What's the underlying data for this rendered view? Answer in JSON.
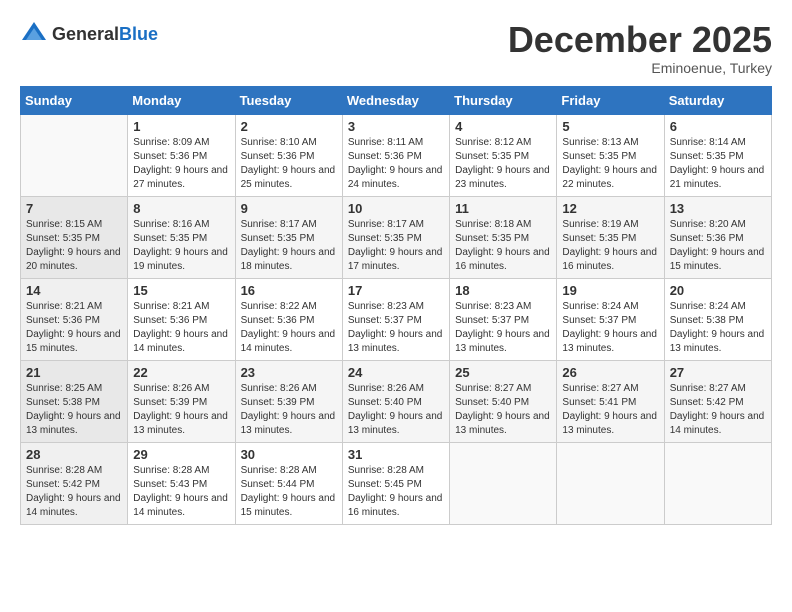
{
  "header": {
    "logo_general": "General",
    "logo_blue": "Blue",
    "month_title": "December 2025",
    "subtitle": "Eminoenue, Turkey"
  },
  "weekdays": [
    "Sunday",
    "Monday",
    "Tuesday",
    "Wednesday",
    "Thursday",
    "Friday",
    "Saturday"
  ],
  "weeks": [
    [
      {
        "day": "",
        "sunrise": "",
        "sunset": "",
        "daylight": ""
      },
      {
        "day": "1",
        "sunrise": "Sunrise: 8:09 AM",
        "sunset": "Sunset: 5:36 PM",
        "daylight": "Daylight: 9 hours and 27 minutes."
      },
      {
        "day": "2",
        "sunrise": "Sunrise: 8:10 AM",
        "sunset": "Sunset: 5:36 PM",
        "daylight": "Daylight: 9 hours and 25 minutes."
      },
      {
        "day": "3",
        "sunrise": "Sunrise: 8:11 AM",
        "sunset": "Sunset: 5:36 PM",
        "daylight": "Daylight: 9 hours and 24 minutes."
      },
      {
        "day": "4",
        "sunrise": "Sunrise: 8:12 AM",
        "sunset": "Sunset: 5:35 PM",
        "daylight": "Daylight: 9 hours and 23 minutes."
      },
      {
        "day": "5",
        "sunrise": "Sunrise: 8:13 AM",
        "sunset": "Sunset: 5:35 PM",
        "daylight": "Daylight: 9 hours and 22 minutes."
      },
      {
        "day": "6",
        "sunrise": "Sunrise: 8:14 AM",
        "sunset": "Sunset: 5:35 PM",
        "daylight": "Daylight: 9 hours and 21 minutes."
      }
    ],
    [
      {
        "day": "7",
        "sunrise": "Sunrise: 8:15 AM",
        "sunset": "Sunset: 5:35 PM",
        "daylight": "Daylight: 9 hours and 20 minutes."
      },
      {
        "day": "8",
        "sunrise": "Sunrise: 8:16 AM",
        "sunset": "Sunset: 5:35 PM",
        "daylight": "Daylight: 9 hours and 19 minutes."
      },
      {
        "day": "9",
        "sunrise": "Sunrise: 8:17 AM",
        "sunset": "Sunset: 5:35 PM",
        "daylight": "Daylight: 9 hours and 18 minutes."
      },
      {
        "day": "10",
        "sunrise": "Sunrise: 8:17 AM",
        "sunset": "Sunset: 5:35 PM",
        "daylight": "Daylight: 9 hours and 17 minutes."
      },
      {
        "day": "11",
        "sunrise": "Sunrise: 8:18 AM",
        "sunset": "Sunset: 5:35 PM",
        "daylight": "Daylight: 9 hours and 16 minutes."
      },
      {
        "day": "12",
        "sunrise": "Sunrise: 8:19 AM",
        "sunset": "Sunset: 5:35 PM",
        "daylight": "Daylight: 9 hours and 16 minutes."
      },
      {
        "day": "13",
        "sunrise": "Sunrise: 8:20 AM",
        "sunset": "Sunset: 5:36 PM",
        "daylight": "Daylight: 9 hours and 15 minutes."
      }
    ],
    [
      {
        "day": "14",
        "sunrise": "Sunrise: 8:21 AM",
        "sunset": "Sunset: 5:36 PM",
        "daylight": "Daylight: 9 hours and 15 minutes."
      },
      {
        "day": "15",
        "sunrise": "Sunrise: 8:21 AM",
        "sunset": "Sunset: 5:36 PM",
        "daylight": "Daylight: 9 hours and 14 minutes."
      },
      {
        "day": "16",
        "sunrise": "Sunrise: 8:22 AM",
        "sunset": "Sunset: 5:36 PM",
        "daylight": "Daylight: 9 hours and 14 minutes."
      },
      {
        "day": "17",
        "sunrise": "Sunrise: 8:23 AM",
        "sunset": "Sunset: 5:37 PM",
        "daylight": "Daylight: 9 hours and 13 minutes."
      },
      {
        "day": "18",
        "sunrise": "Sunrise: 8:23 AM",
        "sunset": "Sunset: 5:37 PM",
        "daylight": "Daylight: 9 hours and 13 minutes."
      },
      {
        "day": "19",
        "sunrise": "Sunrise: 8:24 AM",
        "sunset": "Sunset: 5:37 PM",
        "daylight": "Daylight: 9 hours and 13 minutes."
      },
      {
        "day": "20",
        "sunrise": "Sunrise: 8:24 AM",
        "sunset": "Sunset: 5:38 PM",
        "daylight": "Daylight: 9 hours and 13 minutes."
      }
    ],
    [
      {
        "day": "21",
        "sunrise": "Sunrise: 8:25 AM",
        "sunset": "Sunset: 5:38 PM",
        "daylight": "Daylight: 9 hours and 13 minutes."
      },
      {
        "day": "22",
        "sunrise": "Sunrise: 8:26 AM",
        "sunset": "Sunset: 5:39 PM",
        "daylight": "Daylight: 9 hours and 13 minutes."
      },
      {
        "day": "23",
        "sunrise": "Sunrise: 8:26 AM",
        "sunset": "Sunset: 5:39 PM",
        "daylight": "Daylight: 9 hours and 13 minutes."
      },
      {
        "day": "24",
        "sunrise": "Sunrise: 8:26 AM",
        "sunset": "Sunset: 5:40 PM",
        "daylight": "Daylight: 9 hours and 13 minutes."
      },
      {
        "day": "25",
        "sunrise": "Sunrise: 8:27 AM",
        "sunset": "Sunset: 5:40 PM",
        "daylight": "Daylight: 9 hours and 13 minutes."
      },
      {
        "day": "26",
        "sunrise": "Sunrise: 8:27 AM",
        "sunset": "Sunset: 5:41 PM",
        "daylight": "Daylight: 9 hours and 13 minutes."
      },
      {
        "day": "27",
        "sunrise": "Sunrise: 8:27 AM",
        "sunset": "Sunset: 5:42 PM",
        "daylight": "Daylight: 9 hours and 14 minutes."
      }
    ],
    [
      {
        "day": "28",
        "sunrise": "Sunrise: 8:28 AM",
        "sunset": "Sunset: 5:42 PM",
        "daylight": "Daylight: 9 hours and 14 minutes."
      },
      {
        "day": "29",
        "sunrise": "Sunrise: 8:28 AM",
        "sunset": "Sunset: 5:43 PM",
        "daylight": "Daylight: 9 hours and 14 minutes."
      },
      {
        "day": "30",
        "sunrise": "Sunrise: 8:28 AM",
        "sunset": "Sunset: 5:44 PM",
        "daylight": "Daylight: 9 hours and 15 minutes."
      },
      {
        "day": "31",
        "sunrise": "Sunrise: 8:28 AM",
        "sunset": "Sunset: 5:45 PM",
        "daylight": "Daylight: 9 hours and 16 minutes."
      },
      {
        "day": "",
        "sunrise": "",
        "sunset": "",
        "daylight": ""
      },
      {
        "day": "",
        "sunrise": "",
        "sunset": "",
        "daylight": ""
      },
      {
        "day": "",
        "sunrise": "",
        "sunset": "",
        "daylight": ""
      }
    ]
  ]
}
